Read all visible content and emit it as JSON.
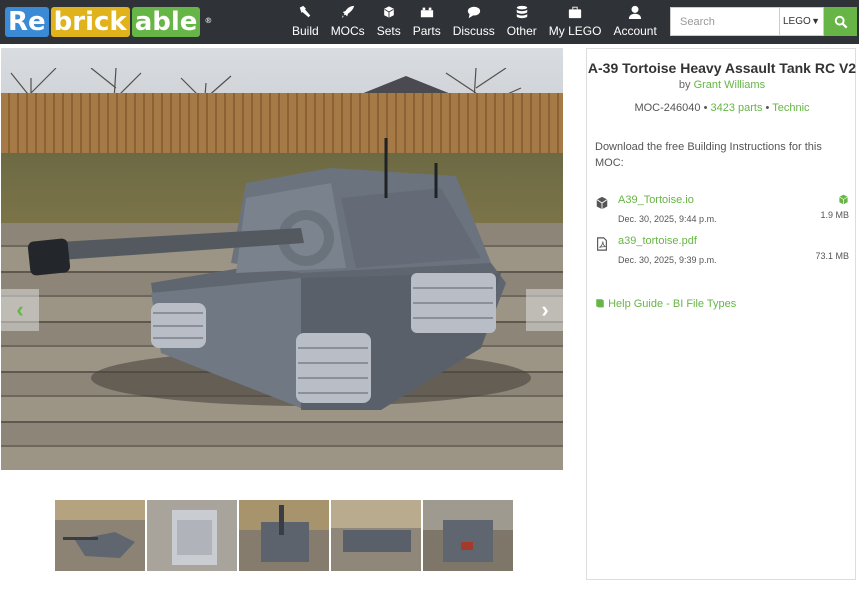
{
  "logo": {
    "part1": "Re",
    "part2": "brick",
    "part3": "able",
    "tm": "®"
  },
  "nav": [
    {
      "label": "Build",
      "icon": "hammer-icon"
    },
    {
      "label": "MOCs",
      "icon": "rocket-icon"
    },
    {
      "label": "Sets",
      "icon": "cube-icon"
    },
    {
      "label": "Parts",
      "icon": "brick-icon"
    },
    {
      "label": "Discuss",
      "icon": "chat-icon"
    },
    {
      "label": "Other",
      "icon": "database-icon"
    },
    {
      "label": "My LEGO",
      "icon": "suitcase-icon"
    },
    {
      "label": "Account",
      "icon": "user-icon"
    }
  ],
  "search": {
    "placeholder": "Search",
    "select_value": "LEGO"
  },
  "moc": {
    "title": "A-39 Tortoise Heavy Assault Tank RC V2",
    "by": "by",
    "author": "Grant Williams",
    "id": "MOC-246040",
    "sep1": "•",
    "parts": "3423 parts",
    "sep2": "•",
    "theme": "Technic",
    "download_text": "Download the free Building Instructions for this MOC:"
  },
  "files": [
    {
      "name": "A39_Tortoise.io",
      "date": "Dec. 30, 2025, 9:44 p.m.",
      "size": "1.9 MB",
      "icon": "box-icon"
    },
    {
      "name": "a39_tortoise.pdf",
      "date": "Dec. 30, 2025, 9:39 p.m.",
      "size": "73.1 MB",
      "icon": "pdf-icon"
    }
  ],
  "help_link": "Help Guide - BI File Types",
  "colors": {
    "green": "#67b546",
    "topbar": "#2f3337",
    "blue": "#3a8ad6",
    "yellow": "#e0b31d"
  }
}
